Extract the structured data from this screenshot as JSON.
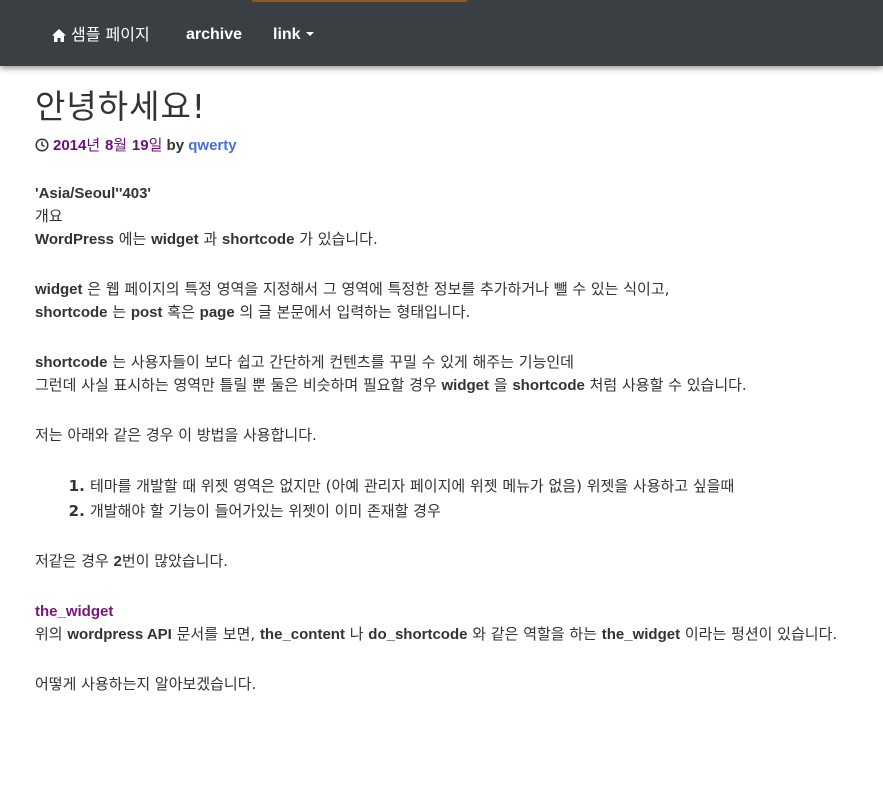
{
  "nav": {
    "home_label": "샘플 페이지",
    "archive_label": "archive",
    "link_label": "link",
    "icon": "home-icon"
  },
  "post": {
    "title": "안녕하세요!",
    "date_year": "2014",
    "date_year_unit": "년 ",
    "date_month": "8",
    "date_month_unit": "월 ",
    "date_day": "19",
    "date_day_unit": "일",
    "by": "by",
    "author": "qwerty"
  },
  "body": {
    "tz": "'Asia/Seoul''403'",
    "overview": "개요",
    "p1": {
      "a": "WordPress",
      "b": " 에는 ",
      "c": "widget",
      "d": " 과 ",
      "e": "shortcode",
      "f": " 가 있습니다."
    },
    "p2": {
      "a": "widget",
      "b": " 은 웹 페이지의 특정 영역을 지정해서 그 영역에 특정한 정보를 추가하거나 뺄 수 있는 식이고,"
    },
    "p3": {
      "a": "shortcode",
      "b": " 는 ",
      "c": "post",
      "d": " 혹은 ",
      "e": "page",
      "f": " 의 글 본문에서 입력하는 형태입니다."
    },
    "p4": {
      "a": "shortcode",
      "b": " 는 사용자들이 보다 쉽고 간단하게 컨텐츠를 꾸밀 수 있게 해주는 기능인데"
    },
    "p5": {
      "a": "그런데 사실 표시하는 영역만 틀릴 뿐 둘은 비슷하며 필요할 경우 ",
      "b": "widget",
      "c": " 을 ",
      "d": "shortcode",
      "e": " 처럼 사용할 수 있습니다."
    },
    "p6": "저는 아래와 같은 경우 이 방법을 사용합니다.",
    "list": [
      "테마를 개발할 때 위젯 영역은 없지만 (아예 관리자 페이지에 위젯 메뉴가 없음) 위젯을 사용하고 싶을때",
      "개발해야 할 기능이 들어가있는 위젯이 이미 존재할 경우"
    ],
    "p7": {
      "a": "저같은 경우 ",
      "b": "2",
      "c": "번이 많았습니다."
    },
    "heading": "the_widget",
    "p8": {
      "a": "위의 ",
      "b": "wordpress API",
      "c": " 문서를 보면, ",
      "d": "the_content",
      "e": " 나 ",
      "f": "do_shortcode",
      "g": " 와 같은 역할을 하는 ",
      "h": "the_widget",
      "i": " 이라는 펑션이 있습니다."
    },
    "p9": "어떻게 사용하는지 알아보겠습니다."
  }
}
